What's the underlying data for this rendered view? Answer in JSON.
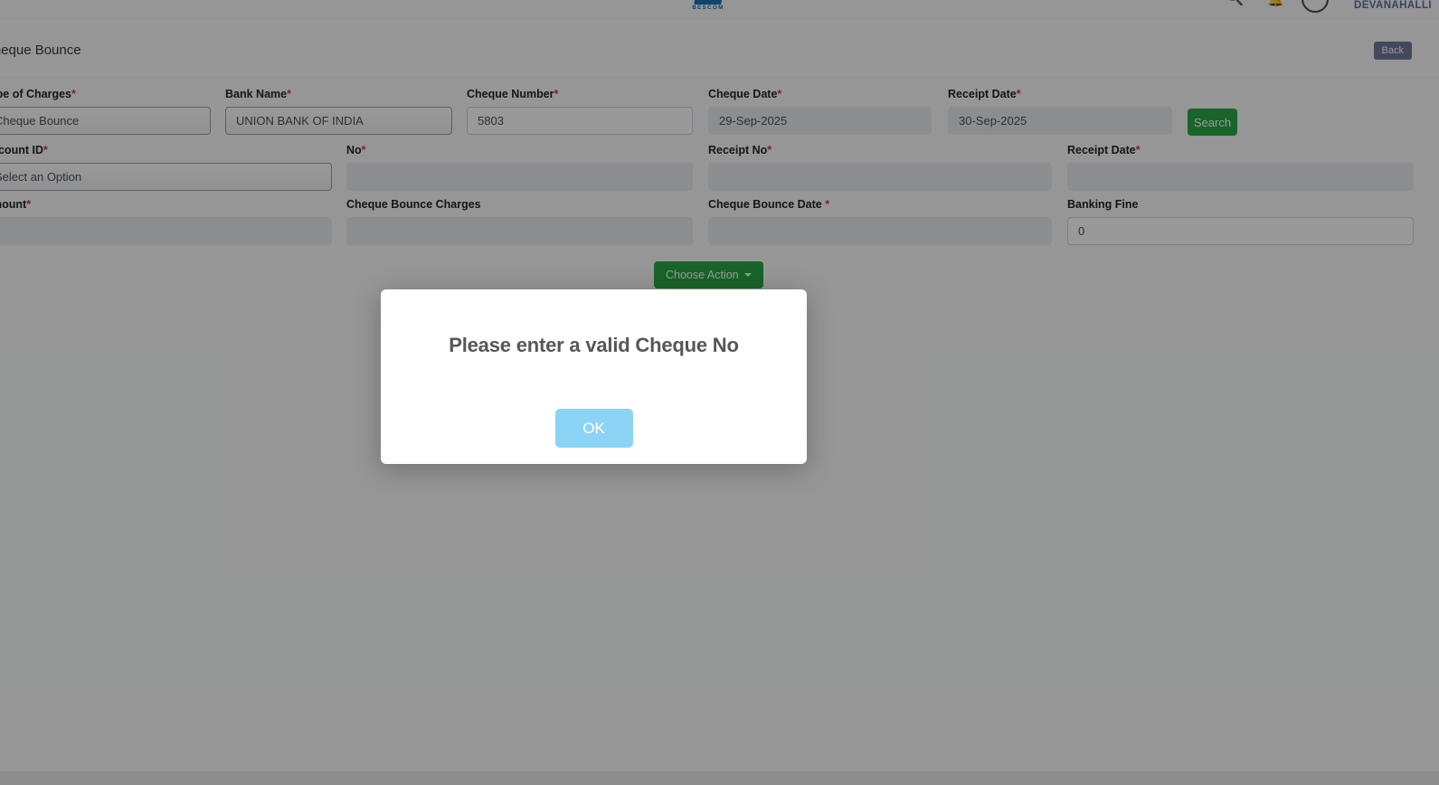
{
  "header": {
    "logo_text": "BESCOM",
    "username": "DEVANAHALLI"
  },
  "page": {
    "title": "Cheque Bounce",
    "back_label": "Back"
  },
  "form": {
    "fields": [
      {
        "label": "Type of Charges",
        "star": "*",
        "value": "Cheque Bounce"
      },
      {
        "label": "Bank Name",
        "star": "*",
        "value": "UNION BANK OF INDIA"
      },
      {
        "label": "Cheque Number",
        "star": "*",
        "value": "5803"
      },
      {
        "label": "Cheque Date",
        "star": "*",
        "value": "29-Sep-2025"
      },
      {
        "label": "Receipt Date",
        "star": "*",
        "value": "30-Sep-2025"
      },
      {
        "label": "Account ID",
        "star": "*",
        "value": "Select an Option"
      },
      {
        "label": "No",
        "star": "*",
        "value": ""
      },
      {
        "label": "Receipt No",
        "star": "*",
        "value": ""
      },
      {
        "label": "Receipt Date",
        "star": "*",
        "value": ""
      },
      {
        "label": "Amount",
        "star": "*",
        "value": ""
      },
      {
        "label": "Cheque Bounce Charges",
        "star": "",
        "value": ""
      },
      {
        "label": "Cheque Bounce Date",
        "star": " *",
        "value": ""
      },
      {
        "label": "Banking Fine",
        "star": "",
        "value": "0"
      }
    ],
    "search_label": "Search",
    "choose_action_label": "Choose Action"
  },
  "modal": {
    "message": "Please enter a valid Cheque No",
    "ok_label": "OK"
  },
  "colors": {
    "accent_green": "#28a745",
    "ok_blue": "#8CD4F5",
    "required_red": "#cf3a44",
    "back_button": "#717b9b",
    "logo_blue": "#1a73b5"
  }
}
